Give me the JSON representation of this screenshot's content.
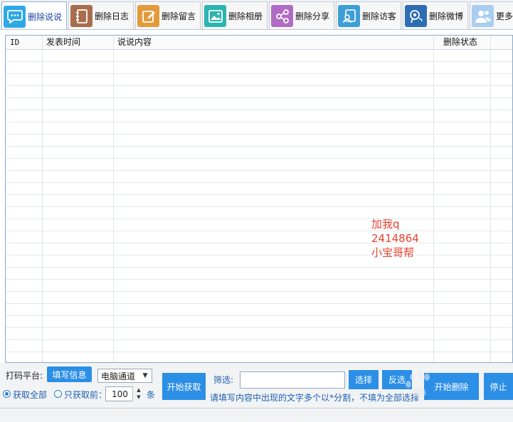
{
  "tabs": [
    {
      "label": "删除说说",
      "icon": "chat-bubble-icon",
      "color": "#2ea8e6",
      "active": true
    },
    {
      "label": "删除日志",
      "icon": "notebook-icon",
      "color": "#a86d4d",
      "active": false
    },
    {
      "label": "删除留言",
      "icon": "edit-note-icon",
      "color": "#e39a3a",
      "active": false
    },
    {
      "label": "删除相册",
      "icon": "photo-icon",
      "color": "#2bb5b0",
      "active": false
    },
    {
      "label": "删除分享",
      "icon": "share-icon",
      "color": "#b06bc4",
      "active": false
    },
    {
      "label": "删除访客",
      "icon": "visitor-icon",
      "color": "#3d9fd6",
      "active": false
    },
    {
      "label": "删除微博",
      "icon": "weibo-icon",
      "color": "#2e6db3",
      "active": false
    },
    {
      "label": "更多",
      "icon": "users-icon",
      "color": "#5aa0e0",
      "active": false
    }
  ],
  "table": {
    "columns": [
      "ID",
      "发表时间",
      "说说内容",
      "删除状态"
    ],
    "rows": []
  },
  "overlay_text": [
    "加我q",
    "2414864",
    "小宝哥帮"
  ],
  "bottom": {
    "captcha_label": "打码平台:",
    "fill_info_button": "填写信息",
    "channel_select": "电脑通道",
    "fetch_all_label": "获取全部",
    "fetch_first_label": "只获取前：",
    "fetch_count": "100",
    "count_unit": "条",
    "start_fetch_button": "开始获取",
    "filter_label": "筛选:",
    "filter_value": "",
    "select_button": "选择",
    "invert_button": "反选",
    "start_delete_button": "开始删除",
    "stop_button": "停止",
    "hint": "请填写内容中出现的文字多个以*分割，不填为全部选择"
  },
  "colors": {
    "button_blue": "#2b8fe6",
    "overlay_red": "#e8402f",
    "hint_blue": "#1f5fb0"
  }
}
